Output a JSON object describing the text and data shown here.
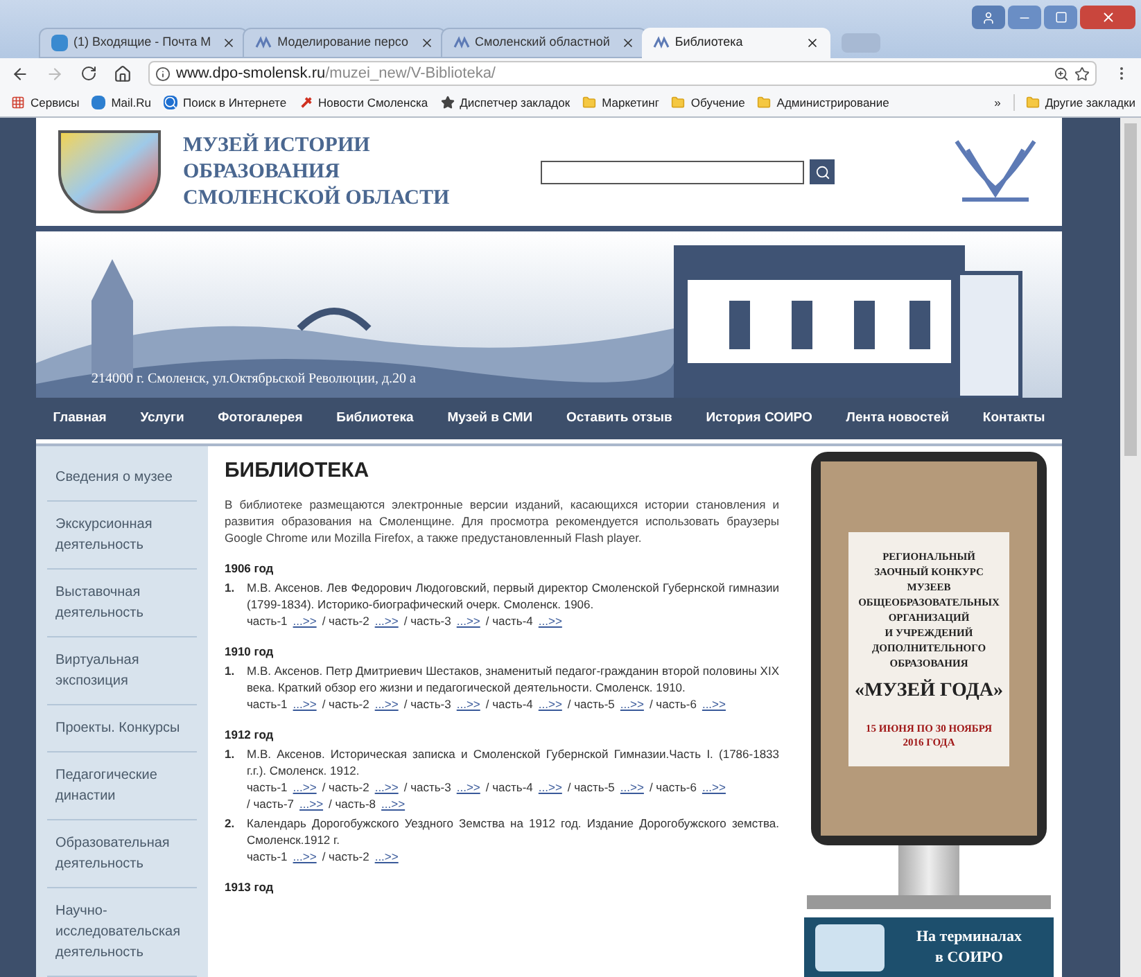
{
  "browser": {
    "tabs": [
      {
        "title": "(1) Входящие - Почта М",
        "kind": "mail",
        "selected": false
      },
      {
        "title": "Моделирование персо",
        "kind": "site",
        "selected": false
      },
      {
        "title": "Смоленский областной",
        "kind": "site",
        "selected": false
      },
      {
        "title": "Библиотека",
        "kind": "site",
        "selected": true
      }
    ],
    "url": {
      "domain": "www.dpo-smolensk.ru",
      "path": "/muzei_new/V-Biblioteka/"
    },
    "bookmarks": [
      {
        "label": "Сервисы",
        "kind": "apps"
      },
      {
        "label": "Mail.Ru",
        "kind": "mail"
      },
      {
        "label": "Поиск в Интернете",
        "kind": "search"
      },
      {
        "label": "Новости Смоленска",
        "kind": "news"
      },
      {
        "label": "Диспетчер закладок",
        "kind": "star"
      },
      {
        "label": "Маркетинг",
        "kind": "folder"
      },
      {
        "label": "Обучение",
        "kind": "folder"
      },
      {
        "label": "Администрирование",
        "kind": "folder"
      }
    ],
    "bookmarks_overflow": "»",
    "other_bookmarks": "Другие закладки"
  },
  "header": {
    "title_lines": [
      "МУЗЕЙ ИСТОРИИ",
      "ОБРАЗОВАНИЯ",
      "СМОЛЕНСКОЙ ОБЛАСТИ"
    ],
    "banner_address": "214000 г. Смоленск, ул.Октябрьской Революции, д.20 а"
  },
  "nav": [
    "Главная",
    "Услуги",
    "Фотогалерея",
    "Библиотека",
    "Музей в СМИ",
    "Оставить отзыв",
    "История СОИРО",
    "Лента новостей",
    "Контакты"
  ],
  "sidebar": [
    [
      "Сведения о музее"
    ],
    [
      "Экскурсионная",
      "деятельность"
    ],
    [
      "Выставочная",
      "деятельность"
    ],
    [
      "Виртуальная",
      "экспозиция"
    ],
    [
      "Проекты. Конкурсы"
    ],
    [
      "Педагогические",
      "династии"
    ],
    [
      "Образовательная",
      "деятельность"
    ],
    [
      "Научно-",
      "исследовательская",
      "деятельность"
    ]
  ],
  "content": {
    "title": "БИБЛИОТЕКА",
    "intro": "В библиотеке размещаются электронные версии изданий, касающихся истории становления и развития образования на Смоленщине. Для просмотра рекомендуется использовать браузеры Google Chrome или Mozilla Firefox, а также предустановленный Flash player.",
    "sections": [
      {
        "year": "1906 год",
        "entries": [
          {
            "number": "1.",
            "text": "М.В. Аксенов. Лев Федорович Людоговский, первый директор Смоленской Губернской гимназии (1799-1834). Историко-биографический очерк. Смоленск. 1906.",
            "parts": [
              {
                "label": "часть-1",
                "link": "...>>"
              },
              {
                "label": "/ часть-2",
                "link": "...>>"
              },
              {
                "label": "/ часть-3",
                "link": "...>>"
              },
              {
                "label": "/ часть-4",
                "link": "...>>"
              }
            ]
          }
        ]
      },
      {
        "year": "1910 год",
        "entries": [
          {
            "number": "1.",
            "text": "М.В. Аксенов. Петр Дмитриевич Шестаков, знаменитый педагог-гражданин второй половины XIX века. Краткий обзор его жизни и педагогической деятельности. Смоленск. 1910.",
            "parts": [
              {
                "label": "часть-1",
                "link": "...>>"
              },
              {
                "label": "/ часть-2",
                "link": "...>>"
              },
              {
                "label": "/ часть-3",
                "link": "...>>"
              },
              {
                "label": "/ часть-4",
                "link": "...>>"
              },
              {
                "label": "/ часть-5",
                "link": "...>>"
              },
              {
                "label": "/ часть-6",
                "link": "...>>"
              }
            ]
          }
        ]
      },
      {
        "year": "1912 год",
        "entries": [
          {
            "number": "1.",
            "text": "М.В. Аксенов. Историческая записка и Смоленской Губернской Гимназии.Часть I. (1786-1833 г.г.). Смоленск. 1912.",
            "parts": [
              {
                "label": "часть-1",
                "link": "...>>"
              },
              {
                "label": "/ часть-2",
                "link": "...>>"
              },
              {
                "label": "/ часть-3",
                "link": "...>>"
              },
              {
                "label": "/ часть-4",
                "link": "...>>"
              },
              {
                "label": "/ часть-5",
                "link": "...>>"
              },
              {
                "label": "/ часть-6",
                "link": "...>>"
              },
              {
                "label": "/ часть-7",
                "link": "...>>"
              },
              {
                "label": "/ часть-8",
                "link": "...>>"
              }
            ]
          },
          {
            "number": "2.",
            "text": "Календарь Дорогобужского Уездного Земства на 1912 год. Издание Дорогобужского земства. Смоленск.1912 г.",
            "parts": [
              {
                "label": "часть-1",
                "link": "...>>"
              },
              {
                "label": "/ часть-2",
                "link": "...>>"
              }
            ]
          }
        ]
      },
      {
        "year": "1913 год"
      }
    ]
  },
  "poster": {
    "lines": [
      "РЕГИОНАЛЬНЫЙ",
      "ЗАОЧНЫЙ КОНКУРС",
      "МУЗЕЕВ",
      "ОБЩЕОБРАЗОВАТЕЛЬНЫХ",
      "ОРГАНИЗАЦИЙ",
      "И УЧРЕЖДЕНИЙ",
      "ДОПОЛНИТЕЛЬНОГО",
      "ОБРАЗОВАНИЯ"
    ],
    "headline": "«МУЗЕЙ ГОДА»",
    "dates": [
      "15 ИЮНЯ ПО 30 НОЯБРЯ",
      "2016 ГОДА"
    ]
  },
  "terminal_banner": [
    "На терминалах",
    "в СОИРО"
  ]
}
